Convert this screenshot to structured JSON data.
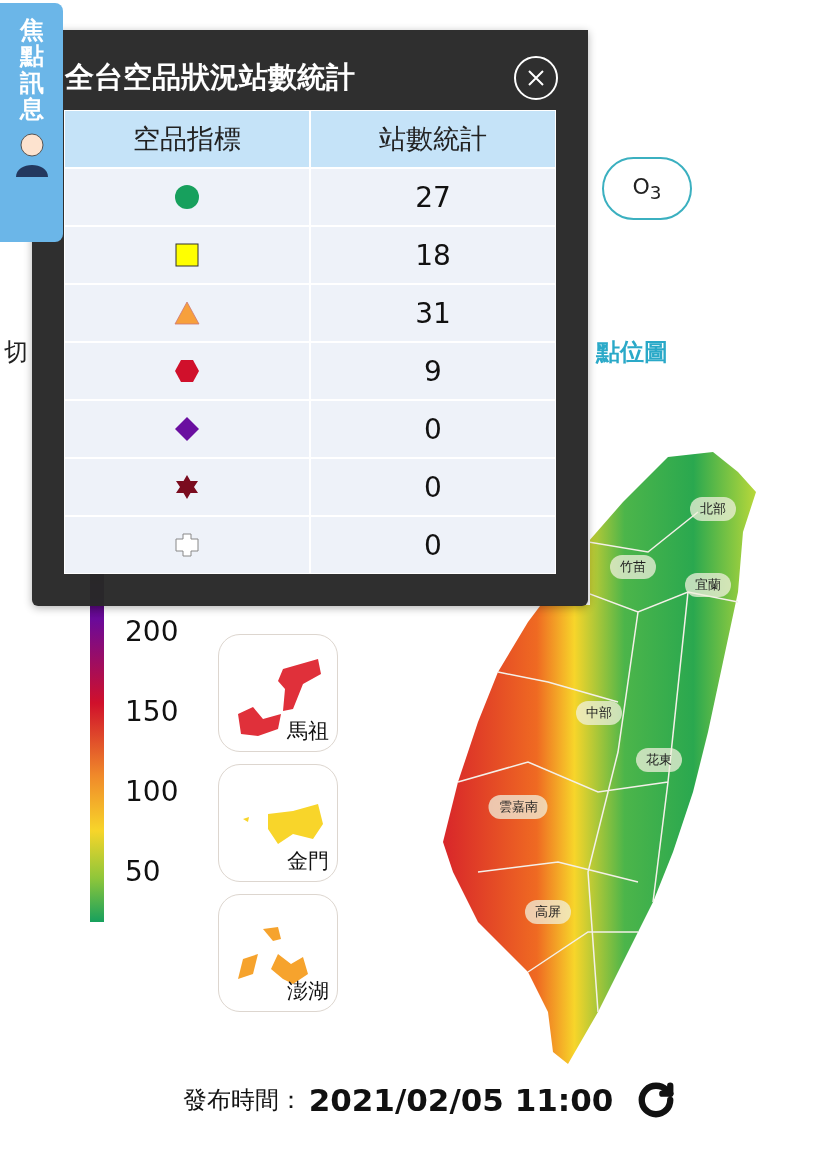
{
  "modal": {
    "title": "全台空品狀況站數統計",
    "columns": [
      "空品指標",
      "站數統計"
    ],
    "rows": [
      {
        "kind": "circle",
        "color": "#17a05d",
        "count": "27"
      },
      {
        "kind": "square",
        "color": "#ffff00",
        "count": "18"
      },
      {
        "kind": "triangle",
        "color": "#f7a03c",
        "count": "31"
      },
      {
        "kind": "hexagon",
        "color": "#d0102b",
        "count": "9"
      },
      {
        "kind": "diamond",
        "color": "#6a0fa0",
        "count": "0"
      },
      {
        "kind": "star",
        "color": "#7a0c1f",
        "count": "0"
      },
      {
        "kind": "cross",
        "color": "#ffffff",
        "count": "0"
      }
    ]
  },
  "side_tab": {
    "label": "焦點訊息"
  },
  "pollutant_button": {
    "label": "O$_{3}$"
  },
  "switch_row": {
    "left_text": "切",
    "right_link": "點位圖"
  },
  "legend": {
    "ticks": [
      "200",
      "150",
      "100",
      "50"
    ]
  },
  "islands": [
    {
      "name": "馬祖",
      "color": "#e0303a"
    },
    {
      "name": "金門",
      "color": "#f8d52a"
    },
    {
      "name": "澎湖",
      "color": "#f6a32d"
    }
  ],
  "map": {
    "regions": [
      "北部",
      "竹苗",
      "宜蘭",
      "中部",
      "花東",
      "雲嘉南",
      "高屏"
    ]
  },
  "publish": {
    "label": "發布時間：",
    "time": "2021/02/05 11:00"
  }
}
